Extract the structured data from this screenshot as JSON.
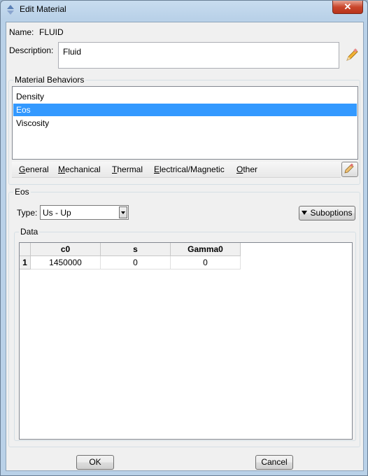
{
  "window": {
    "title": "Edit Material",
    "close_label": "✕"
  },
  "name": {
    "label": "Name:",
    "value": "FLUID"
  },
  "description": {
    "label": "Description:",
    "value": "Fluid"
  },
  "behaviors": {
    "group_title": "Material Behaviors",
    "items": [
      {
        "label": "Density",
        "selected": false
      },
      {
        "label": "Eos",
        "selected": true
      },
      {
        "label": "Viscosity",
        "selected": false
      }
    ]
  },
  "menu": {
    "general": "General",
    "mechanical": "Mechanical",
    "thermal": "Thermal",
    "electrical": "Electrical/Magnetic",
    "other": "Other"
  },
  "eos": {
    "group_title": "Eos",
    "type_label": "Type:",
    "type_value": "Us - Up",
    "suboptions_label": "Suboptions"
  },
  "data": {
    "group_title": "Data",
    "columns": [
      "c0",
      "s",
      "Gamma0"
    ],
    "rows": [
      {
        "index": "1",
        "values": [
          "1450000",
          "0",
          "0"
        ]
      }
    ]
  },
  "buttons": {
    "ok": "OK",
    "cancel": "Cancel"
  },
  "colors": {
    "selection": "#3399ff",
    "titlebar": "#c8dcef",
    "close": "#c9462c"
  },
  "icons": {
    "title": "abaqus-material-icon",
    "description_edit": "pencil-icon",
    "behavior_edit": "pencil-icon"
  }
}
